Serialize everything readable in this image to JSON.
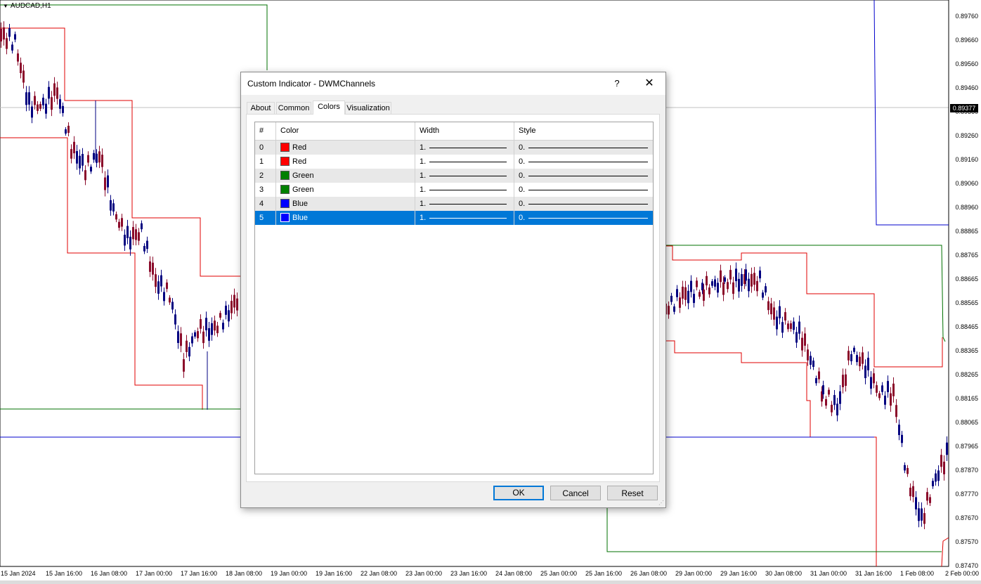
{
  "chart": {
    "symbol": "AUDCAD,H1",
    "current_price": "0.89377",
    "price_levels": [
      "0.89760",
      "0.89660",
      "0.89560",
      "0.89460",
      "0.89360",
      "0.89260",
      "0.89160",
      "0.89060",
      "0.88960",
      "0.88865",
      "0.88765",
      "0.88665",
      "0.88565",
      "0.88465",
      "0.88365",
      "0.88265",
      "0.88165",
      "0.88065",
      "0.87965",
      "0.87870",
      "0.87770",
      "0.87670",
      "0.87570",
      "0.87470"
    ],
    "time_labels": [
      "15 Jan 2024",
      "15 Jan 16:00",
      "16 Jan 08:00",
      "17 Jan 00:00",
      "17 Jan 16:00",
      "18 Jan 08:00",
      "19 Jan 00:00",
      "19 Jan 16:00",
      "22 Jan 08:00",
      "23 Jan 00:00",
      "23 Jan 16:00",
      "24 Jan 08:00",
      "25 Jan 00:00",
      "25 Jan 16:00",
      "26 Jan 08:00",
      "29 Jan 00:00",
      "29 Jan 16:00",
      "30 Jan 08:00",
      "31 Jan 00:00",
      "31 Jan 16:00",
      "1 Feb 08:00",
      "2 Feb 00:00"
    ],
    "colors": {
      "red_channel": "#e00000",
      "green_channel": "#007000",
      "blue_channel": "#0000cc",
      "candle_bull": "#000080",
      "candle_bear": "#8b0a2a"
    }
  },
  "dialog": {
    "title": "Custom Indicator - DWMChannels",
    "help_glyph": "?",
    "close_glyph": "✕",
    "tabs": [
      {
        "label": "About",
        "active": false
      },
      {
        "label": "Common",
        "active": false
      },
      {
        "label": "Colors",
        "active": true
      },
      {
        "label": "Visualization",
        "active": false
      }
    ],
    "columns": [
      "#",
      "Color",
      "Width",
      "Style"
    ],
    "rows": [
      {
        "index": "0",
        "color_name": "Red",
        "color": "#ff0000",
        "width": "1.",
        "style": "0.",
        "selected": false
      },
      {
        "index": "1",
        "color_name": "Red",
        "color": "#ff0000",
        "width": "1.",
        "style": "0.",
        "selected": false
      },
      {
        "index": "2",
        "color_name": "Green",
        "color": "#008000",
        "width": "1.",
        "style": "0.",
        "selected": false
      },
      {
        "index": "3",
        "color_name": "Green",
        "color": "#008000",
        "width": "1.",
        "style": "0.",
        "selected": false
      },
      {
        "index": "4",
        "color_name": "Blue",
        "color": "#0000ff",
        "width": "1.",
        "style": "0.",
        "selected": false
      },
      {
        "index": "5",
        "color_name": "Blue",
        "color": "#0000ff",
        "width": "1.",
        "style": "0.",
        "selected": true
      }
    ],
    "buttons": {
      "ok": "OK",
      "cancel": "Cancel",
      "reset": "Reset"
    }
  }
}
